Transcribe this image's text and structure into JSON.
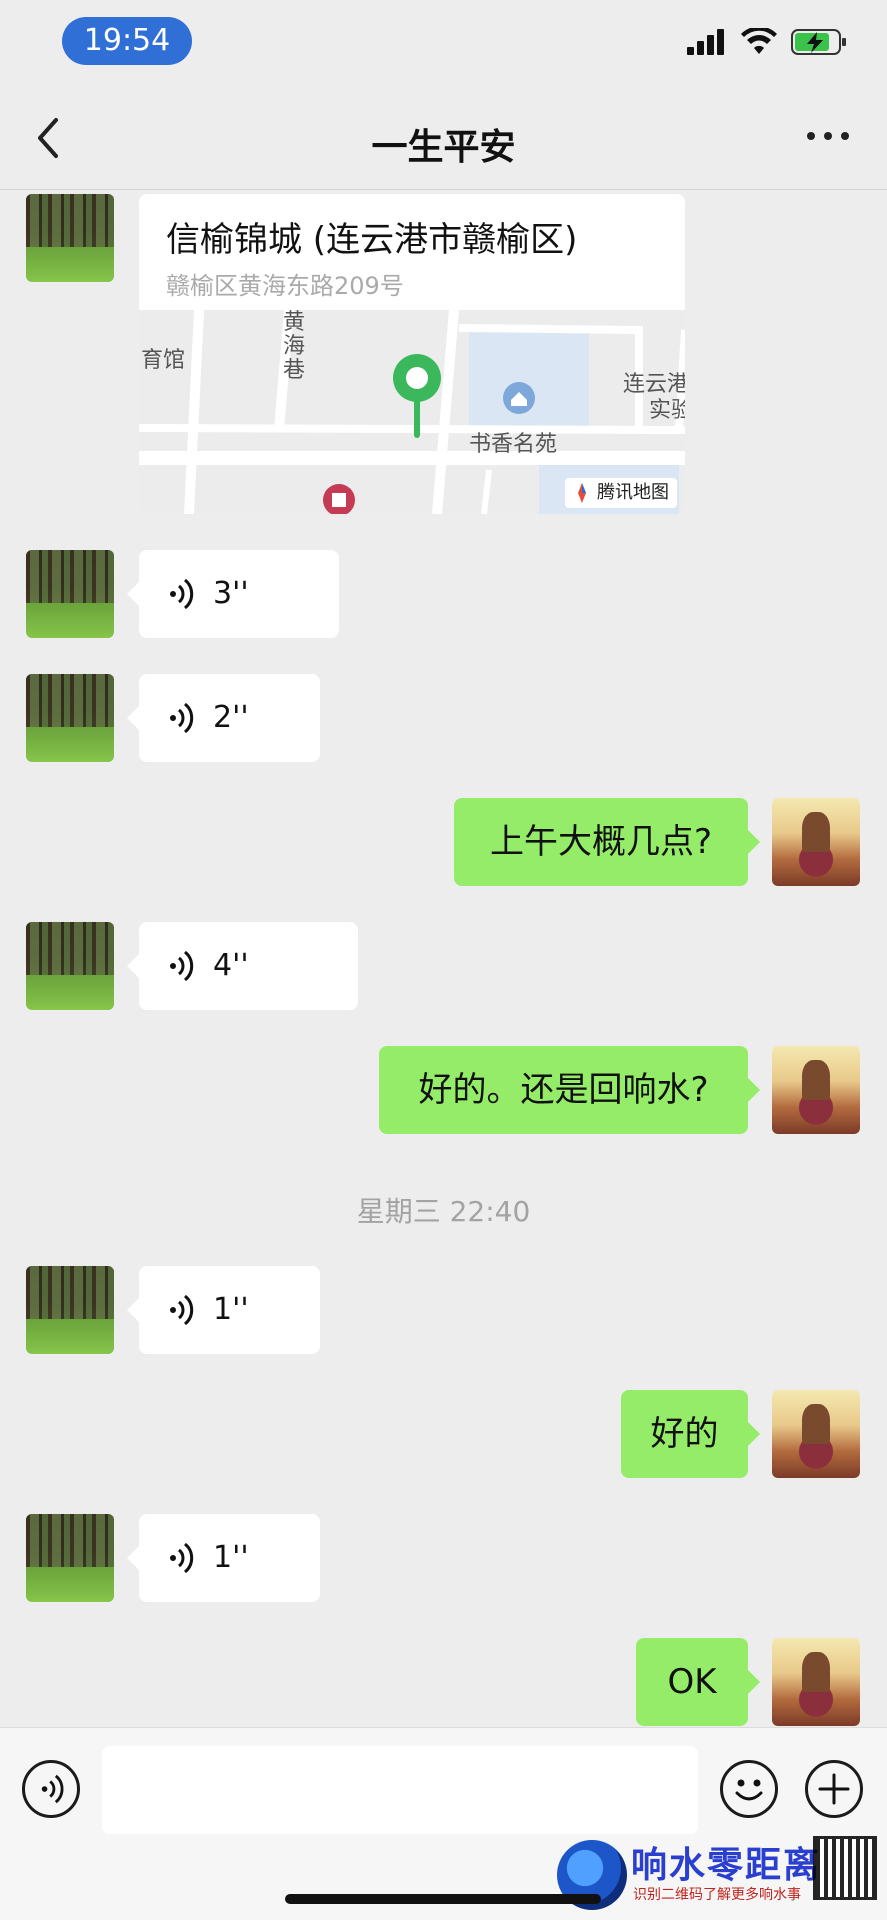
{
  "status_bar": {
    "time": "19:54"
  },
  "nav": {
    "title": "一生平安"
  },
  "location": {
    "name": "信榆锦城 (连云港市赣榆区)",
    "address": "赣榆区黄海东路209号",
    "map_labels": [
      "育馆",
      "黄",
      "海",
      "巷",
      "书香名苑",
      "连云港",
      "实验"
    ],
    "badge": "腾讯地图"
  },
  "messages": [
    {
      "side": "left",
      "type": "voice",
      "duration": "3''"
    },
    {
      "side": "left",
      "type": "voice",
      "duration": "2''"
    },
    {
      "side": "right",
      "type": "text",
      "text": "上午大概几点?"
    },
    {
      "side": "left",
      "type": "voice",
      "duration": "4''"
    },
    {
      "side": "right",
      "type": "text",
      "text": "好的。还是回响水?"
    },
    {
      "side": "center",
      "type": "time",
      "text": "星期三 22:40"
    },
    {
      "side": "left",
      "type": "voice",
      "duration": "1''"
    },
    {
      "side": "right",
      "type": "text",
      "text": "好的"
    },
    {
      "side": "left",
      "type": "voice",
      "duration": "1''"
    },
    {
      "side": "right",
      "type": "text",
      "text": "OK"
    }
  ],
  "watermark": {
    "title": "响水零距离",
    "subtitle": "识别二维码了解更多响水事"
  },
  "colors": {
    "bubble_self": "#95ec69",
    "bubble_other": "#ffffff",
    "background": "#ededed",
    "time_pill": "#2f6fd6"
  }
}
